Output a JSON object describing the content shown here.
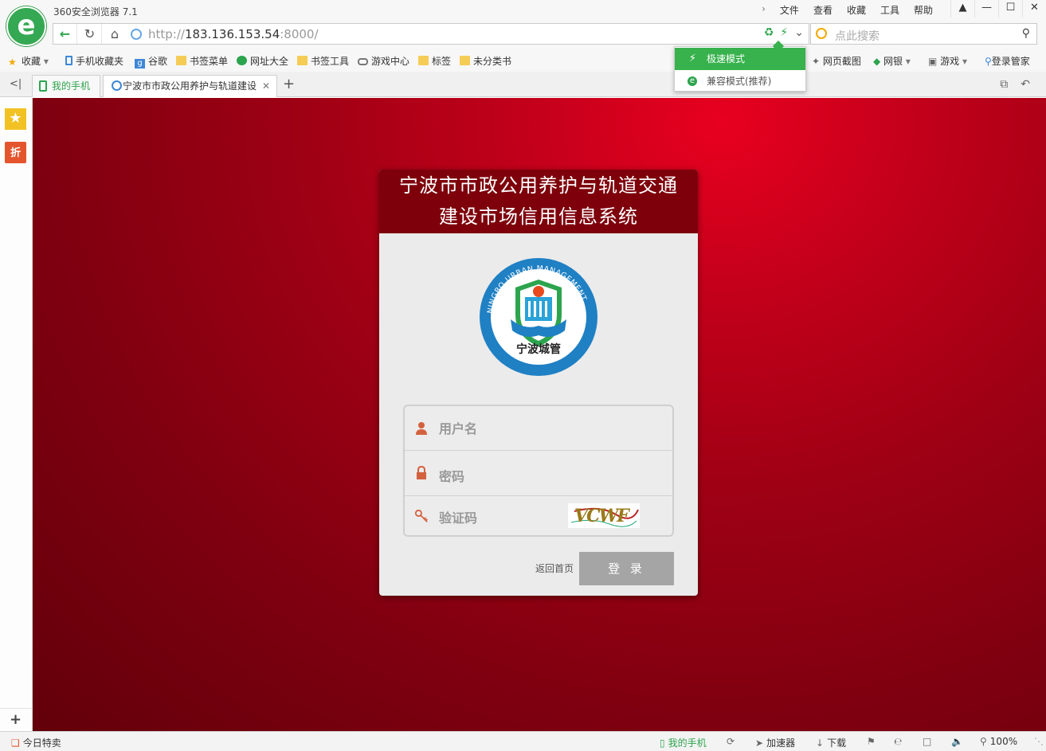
{
  "app": {
    "title": "360安全浏览器 7.1",
    "logo_letter": "e",
    "menu": [
      "文件",
      "查看",
      "收藏",
      "工具",
      "帮助"
    ],
    "window_buttons": [
      "shirt-icon",
      "minimize-icon",
      "maximize-icon",
      "close-icon"
    ]
  },
  "address": {
    "url_host": "http://183.136.153.54",
    "url_host_main": "183.136.153.54",
    "url_prefix": "http://",
    "url_port": ":8000/",
    "search_placeholder": "点此搜索"
  },
  "bookmarks": {
    "items": [
      "收藏",
      "手机收藏夹",
      "谷歌",
      "书签菜单",
      "网址大全",
      "书签工具",
      "游戏中心",
      "标签",
      "未分类书"
    ],
    "right_items": [
      "网页截图",
      "网银",
      "游戏",
      "登录管家"
    ]
  },
  "mode_menu": {
    "fast": "极速模式",
    "compat": "兼容模式(推荐)"
  },
  "tabs": {
    "phone_tab": "我的手机",
    "active_tab": "宁波市市政公用养护与轨道建设",
    "add": "+"
  },
  "sidebar": {
    "zhe_label": "折",
    "add_label": "+"
  },
  "login": {
    "title_line1": "宁波市市政公用养护与轨道交通",
    "title_line2": "建设市场信用信息系统",
    "emblem_ring_text": "NINGBO URBAN MANAGEMENT",
    "emblem_bottom_text": "宁波城管",
    "username_placeholder": "用户名",
    "password_placeholder": "密码",
    "captcha_placeholder": "验证码",
    "captcha_text": "VCWF",
    "back_home": "返回首页",
    "submit": "登 录"
  },
  "status": {
    "today_deal": "今日特卖",
    "my_phone": "我的手机",
    "accelerator": "加速器",
    "download": "下载",
    "zoom": "100%"
  },
  "colors": {
    "accent_green": "#37b24d",
    "page_red": "#a00014",
    "login_header": "#7e000b"
  }
}
